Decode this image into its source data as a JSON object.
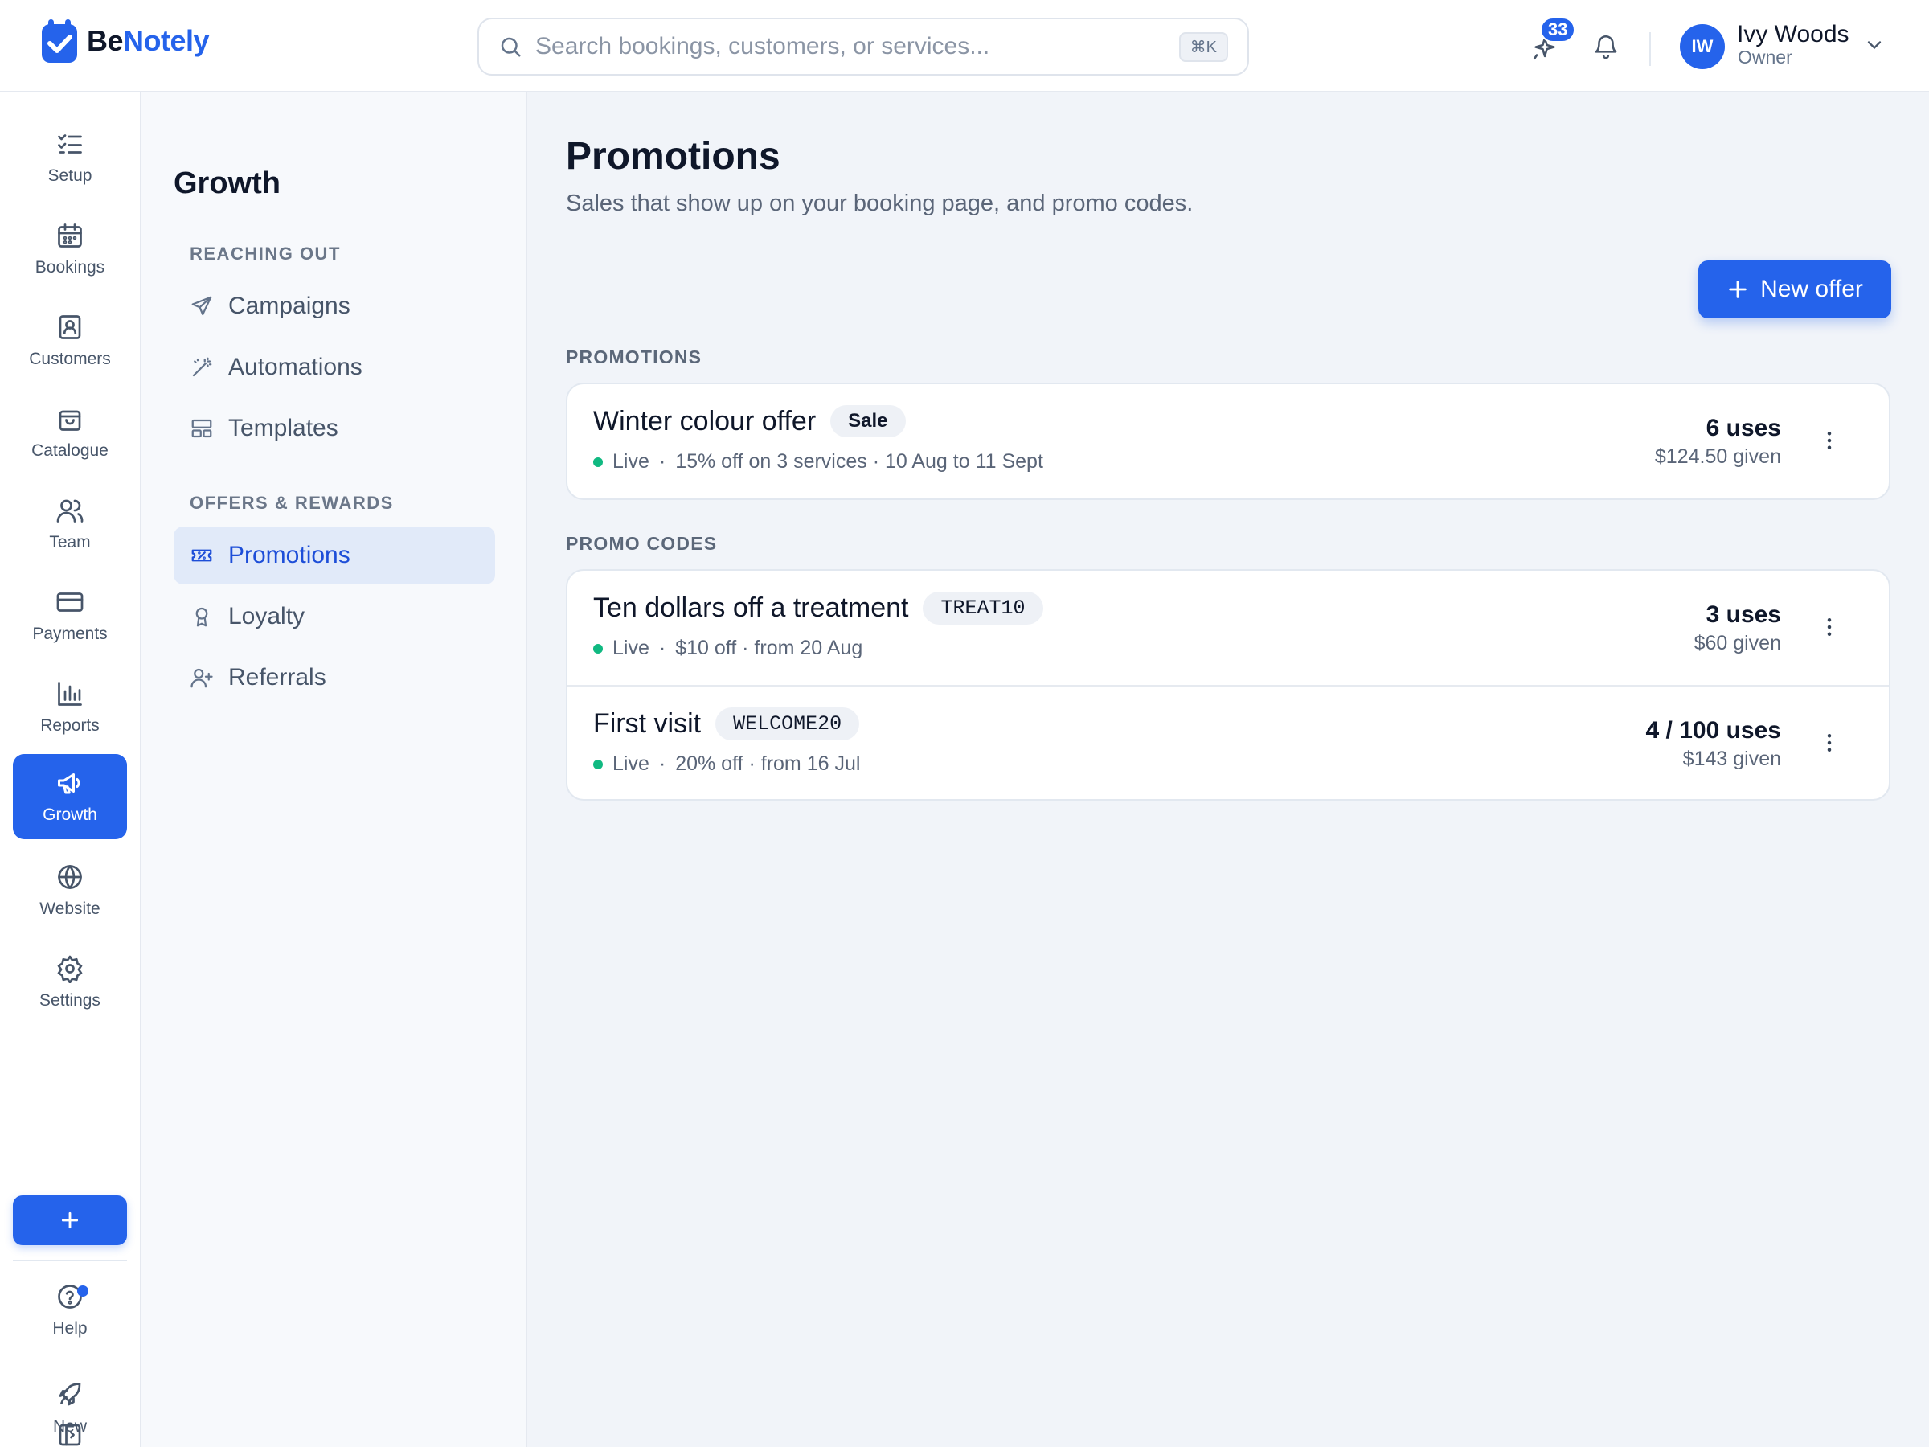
{
  "brand": {
    "name_part1": "Be",
    "name_part2": "Notely",
    "primary": "#2563eb"
  },
  "search": {
    "placeholder": "Search bookings, customers, or services...",
    "shortcut": "⌘K"
  },
  "header": {
    "whats_new_count": "33",
    "user": {
      "initials": "IW",
      "name": "Ivy Woods",
      "role": "Owner"
    }
  },
  "rail": {
    "items": [
      {
        "label": "Setup",
        "icon": "checklist-icon"
      },
      {
        "label": "Bookings",
        "icon": "calendar-icon"
      },
      {
        "label": "Customers",
        "icon": "contact-icon"
      },
      {
        "label": "Catalogue",
        "icon": "bag-icon"
      },
      {
        "label": "Team",
        "icon": "users-icon"
      },
      {
        "label": "Payments",
        "icon": "credit-card-icon"
      },
      {
        "label": "Reports",
        "icon": "bar-chart-icon"
      },
      {
        "label": "Growth",
        "icon": "megaphone-icon",
        "active": true
      },
      {
        "label": "Website",
        "icon": "globe-icon"
      },
      {
        "label": "Settings",
        "icon": "gear-icon"
      }
    ],
    "bottom": [
      {
        "label": "Help",
        "icon": "help-icon"
      },
      {
        "label": "New",
        "icon": "rocket-icon"
      }
    ]
  },
  "subnav": {
    "title": "Growth",
    "groups": [
      {
        "label": "REACHING OUT",
        "items": [
          "Campaigns",
          "Automations",
          "Templates"
        ]
      },
      {
        "label": "OFFERS & REWARDS",
        "items": [
          "Promotions",
          "Loyalty",
          "Referrals"
        ]
      }
    ],
    "active": "Promotions"
  },
  "page": {
    "title": "Promotions",
    "subtitle": "Sales that show up on your booking page, and promo codes.",
    "new_button": "New offer"
  },
  "sections": {
    "promotions": {
      "label": "PROMOTIONS",
      "rows": [
        {
          "title": "Winter colour offer",
          "tag": "Sale",
          "status": "Live",
          "details": "15% off on 3 services · 10 Aug to 11 Sept",
          "uses": "6 uses",
          "given": "$124.50 given"
        }
      ]
    },
    "promo_codes": {
      "label": "PROMO CODES",
      "rows": [
        {
          "title": "Ten dollars off a treatment",
          "tag": "TREAT10",
          "status": "Live",
          "details": "$10 off · from 20 Aug",
          "uses": "3 uses",
          "given": "$60 given"
        },
        {
          "title": "First visit",
          "tag": "WELCOME20",
          "status": "Live",
          "details": "20% off · from 16 Jul",
          "uses": "4 / 100 uses",
          "given": "$143 given"
        }
      ]
    }
  },
  "colors": {
    "live": "#10b981",
    "active_nav_bg": "#e1eaf9"
  }
}
